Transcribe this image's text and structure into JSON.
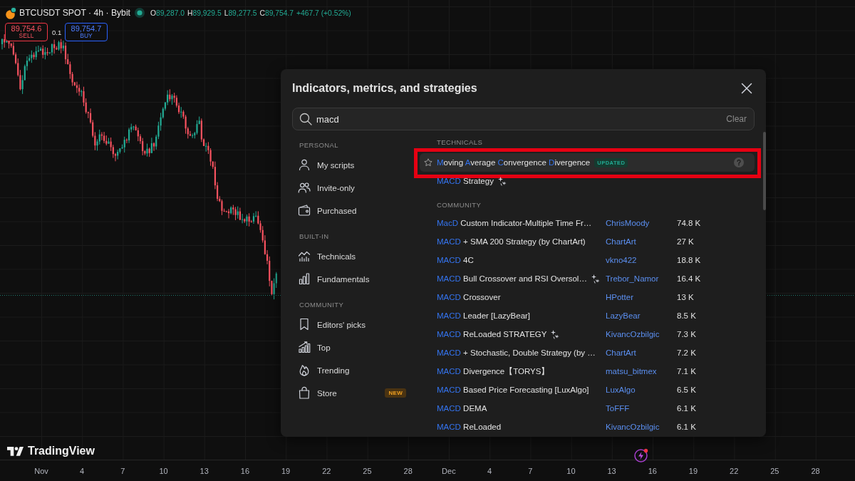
{
  "legend": {
    "symbol": "BTCUSDT SPOT · 4h · Bybit",
    "ohlc": [
      {
        "label": "O",
        "value": "89,287.0"
      },
      {
        "label": "H",
        "value": "89,929.5"
      },
      {
        "label": "L",
        "value": "89,277.5"
      },
      {
        "label": "C",
        "value": "89,754.7"
      }
    ],
    "change": "+467.7 (+0.52%)"
  },
  "order_panel": {
    "sell": {
      "price": "89,754.6",
      "label": "SELL"
    },
    "quantity": "0.1",
    "buy": {
      "price": "89,754.7",
      "label": "BUY"
    }
  },
  "dialog": {
    "title": "Indicators, metrics, and strategies",
    "search": {
      "value": "macd",
      "clear": "Clear"
    },
    "sidebar": [
      {
        "heading": "PERSONAL",
        "items": [
          {
            "label": "My scripts"
          },
          {
            "label": "Invite-only"
          },
          {
            "label": "Purchased"
          }
        ]
      },
      {
        "heading": "BUILT-IN",
        "items": [
          {
            "label": "Technicals"
          },
          {
            "label": "Fundamentals"
          }
        ]
      },
      {
        "heading": "COMMUNITY",
        "items": [
          {
            "label": "Editors' picks"
          },
          {
            "label": "Top"
          },
          {
            "label": "Trending"
          },
          {
            "label": "Store",
            "badge": "NEW"
          }
        ]
      }
    ],
    "results": [
      {
        "heading": "TECHNICALS",
        "rows": [
          {
            "name": [
              {
                "text": "M",
                "match": true
              },
              {
                "text": "oving ",
                "match": false
              },
              {
                "text": "A",
                "match": true
              },
              {
                "text": "verage ",
                "match": false
              },
              {
                "text": "C",
                "match": true
              },
              {
                "text": "onvergence ",
                "match": false
              },
              {
                "text": "D",
                "match": true
              },
              {
                "text": "ivergence",
                "match": false
              }
            ],
            "badge": "UPDATED",
            "strategy": false,
            "selected": true,
            "outlined": true
          },
          {
            "name": [
              {
                "text": "MACD",
                "match": true
              },
              {
                "text": " Strategy",
                "match": false
              }
            ],
            "strategy": true,
            "selected": false,
            "outlined": false
          }
        ]
      },
      {
        "heading": "COMMUNITY",
        "rows": [
          {
            "name": [
              {
                "text": "MacD",
                "match": true
              },
              {
                "text": " Custom Indicator-Multiple Time Fr…",
                "match": false
              }
            ],
            "author": "ChrisMoody",
            "count": "74.8 K",
            "strategy": false,
            "selected": false,
            "outlined": false
          },
          {
            "name": [
              {
                "text": "MACD",
                "match": true
              },
              {
                "text": " + SMA 200 Strategy (by ChartArt)",
                "match": false
              }
            ],
            "author": "ChartArt",
            "count": "27 K",
            "strategy": false,
            "selected": false,
            "outlined": false
          },
          {
            "name": [
              {
                "text": "MACD",
                "match": true
              },
              {
                "text": " 4C",
                "match": false
              }
            ],
            "author": "vkno422",
            "count": "18.8 K",
            "strategy": false,
            "selected": false,
            "outlined": false
          },
          {
            "name": [
              {
                "text": "MACD",
                "match": true
              },
              {
                "text": " Bull Crossover and RSI Oversol…",
                "match": false
              }
            ],
            "author": "Trebor_Namor",
            "count": "16.4 K",
            "strategy": true,
            "selected": false,
            "outlined": false
          },
          {
            "name": [
              {
                "text": "MACD",
                "match": true
              },
              {
                "text": " Crossover",
                "match": false
              }
            ],
            "author": "HPotter",
            "count": "13 K",
            "strategy": false,
            "selected": false,
            "outlined": false
          },
          {
            "name": [
              {
                "text": "MACD",
                "match": true
              },
              {
                "text": " Leader [LazyBear]",
                "match": false
              }
            ],
            "author": "LazyBear",
            "count": "8.5 K",
            "strategy": false,
            "selected": false,
            "outlined": false
          },
          {
            "name": [
              {
                "text": "MACD",
                "match": true
              },
              {
                "text": " ReLoaded STRATEGY",
                "match": false
              }
            ],
            "author": "KivancOzbilgic",
            "count": "7.3 K",
            "strategy": true,
            "selected": false,
            "outlined": false
          },
          {
            "name": [
              {
                "text": "MACD",
                "match": true
              },
              {
                "text": " + Stochastic, Double Strategy (by …",
                "match": false
              }
            ],
            "author": "ChartArt",
            "count": "7.2 K",
            "strategy": false,
            "selected": false,
            "outlined": false
          },
          {
            "name": [
              {
                "text": "MACD",
                "match": true
              },
              {
                "text": " Divergence【TORYS】",
                "match": false
              }
            ],
            "author": "matsu_bitmex",
            "count": "7.1 K",
            "strategy": false,
            "selected": false,
            "outlined": false
          },
          {
            "name": [
              {
                "text": "MACD",
                "match": true
              },
              {
                "text": " Based Price Forecasting [LuxAlgo]",
                "match": false
              }
            ],
            "author": "LuxAlgo",
            "count": "6.5 K",
            "strategy": false,
            "selected": false,
            "outlined": false
          },
          {
            "name": [
              {
                "text": "MACD",
                "match": true
              },
              {
                "text": " DEMA",
                "match": false
              }
            ],
            "author": "ToFFF",
            "count": "6.1 K",
            "strategy": false,
            "selected": false,
            "outlined": false
          },
          {
            "name": [
              {
                "text": "MACD",
                "match": true
              },
              {
                "text": " ReLoaded",
                "match": false
              }
            ],
            "author": "KivancOzbilgic",
            "count": "6.1 K",
            "strategy": false,
            "selected": false,
            "outlined": false
          }
        ]
      }
    ]
  },
  "branding": {
    "name": "TradingView"
  },
  "time_axis": [
    "Nov",
    "4",
    "7",
    "10",
    "13",
    "16",
    "19",
    "22",
    "25",
    "28",
    "Dec",
    "4",
    "7",
    "10",
    "13",
    "16",
    "19",
    "22",
    "25",
    "28"
  ]
}
